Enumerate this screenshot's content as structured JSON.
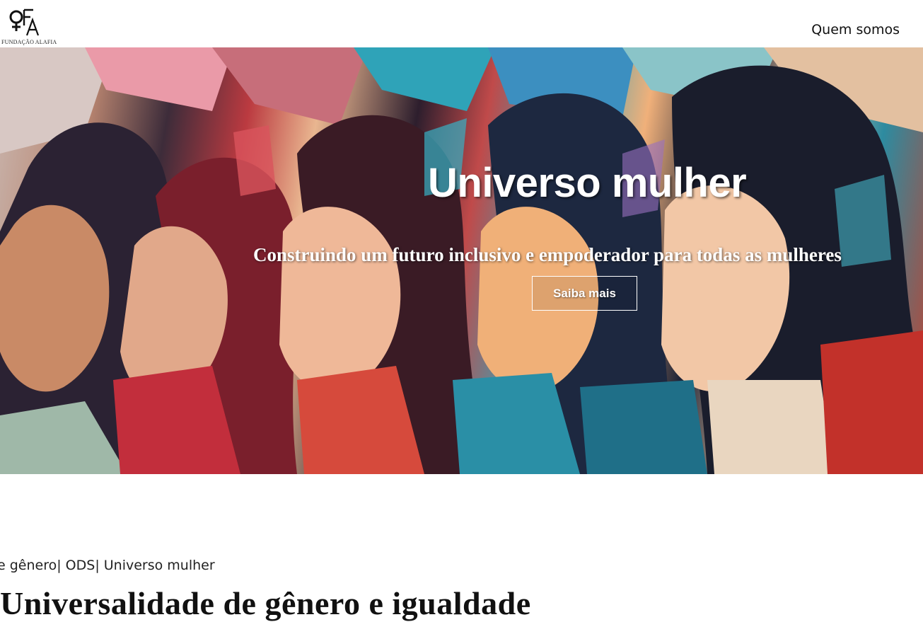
{
  "header": {
    "logo_text": "FUNDAÇÃO ALAFIA",
    "nav": [
      {
        "label": "Quem somos"
      }
    ]
  },
  "hero": {
    "title": "Universo mulher",
    "subtitle": "Construindo um futuro inclusivo e empoderador para todas as mulheres",
    "button_label": "Saiba mais",
    "image_icon": "painted-women-portraits-image"
  },
  "content": {
    "breadcrumb": "e gênero| ODS| Universo mulher",
    "title_partial": "Universalidade de gênero e igualdade"
  }
}
